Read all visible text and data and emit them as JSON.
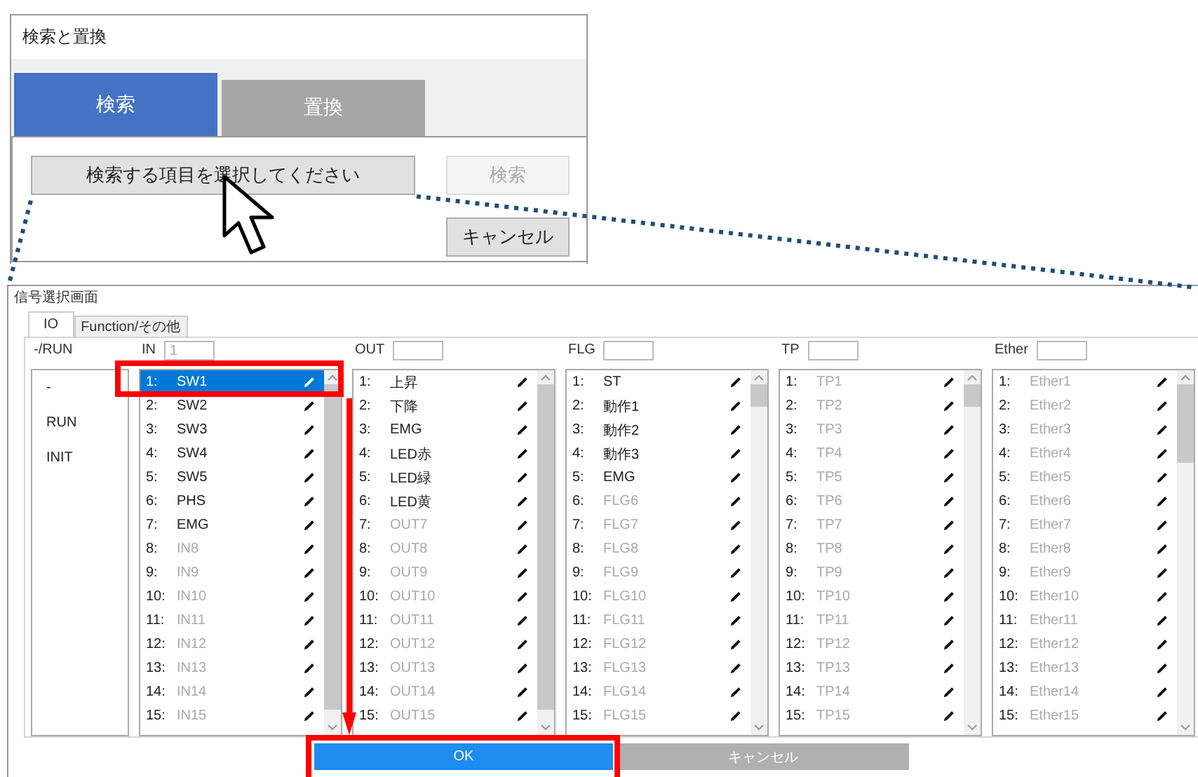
{
  "search_dialog": {
    "title": "検索と置換",
    "tabs": [
      {
        "label": "検索",
        "selected": true
      },
      {
        "label": "置換",
        "selected": false
      }
    ],
    "select_button": "検索する項目を選択してください",
    "search_button": {
      "label": "検索",
      "disabled": true
    },
    "cancel_button": {
      "label": "キャンセル",
      "disabled": false
    }
  },
  "signal_dialog": {
    "title": "信号選択画面",
    "tabs": [
      {
        "label": "IO",
        "selected": true
      },
      {
        "label": "Function/その他",
        "selected": false
      }
    ],
    "mode_list": {
      "header": "-/RUN",
      "items": [
        {
          "label": "-",
          "selected": false
        },
        {
          "label": "RUN",
          "selected": false
        },
        {
          "label": "INIT",
          "selected": false
        }
      ]
    },
    "groups": [
      {
        "header": "IN",
        "filter": "1",
        "items": [
          {
            "number": "1:",
            "label": "SW1",
            "named": true,
            "selected": true
          },
          {
            "number": "2:",
            "label": "SW2",
            "named": true,
            "selected": false
          },
          {
            "number": "3:",
            "label": "SW3",
            "named": true,
            "selected": false
          },
          {
            "number": "4:",
            "label": "SW4",
            "named": true,
            "selected": false
          },
          {
            "number": "5:",
            "label": "SW5",
            "named": true,
            "selected": false
          },
          {
            "number": "6:",
            "label": "PHS",
            "named": true,
            "selected": false
          },
          {
            "number": "7:",
            "label": "EMG",
            "named": true,
            "selected": false
          },
          {
            "number": "8:",
            "label": "IN8",
            "named": false,
            "selected": false
          },
          {
            "number": "9:",
            "label": "IN9",
            "named": false,
            "selected": false
          },
          {
            "number": "10:",
            "label": "IN10",
            "named": false,
            "selected": false
          },
          {
            "number": "11:",
            "label": "IN11",
            "named": false,
            "selected": false
          },
          {
            "number": "12:",
            "label": "IN12",
            "named": false,
            "selected": false
          },
          {
            "number": "13:",
            "label": "IN13",
            "named": false,
            "selected": false
          },
          {
            "number": "14:",
            "label": "IN14",
            "named": false,
            "selected": false
          },
          {
            "number": "15:",
            "label": "IN15",
            "named": false,
            "selected": false
          }
        ]
      },
      {
        "header": "OUT",
        "items": [
          {
            "number": "1:",
            "label": "上昇",
            "named": true,
            "selected": false
          },
          {
            "number": "2:",
            "label": "下降",
            "named": true,
            "selected": false
          },
          {
            "number": "3:",
            "label": "EMG",
            "named": true,
            "selected": false
          },
          {
            "number": "4:",
            "label": "LED赤",
            "named": true,
            "selected": false
          },
          {
            "number": "5:",
            "label": "LED緑",
            "named": true,
            "selected": false
          },
          {
            "number": "6:",
            "label": "LED黄",
            "named": true,
            "selected": false
          },
          {
            "number": "7:",
            "label": "OUT7",
            "named": false,
            "selected": false
          },
          {
            "number": "8:",
            "label": "OUT8",
            "named": false,
            "selected": false
          },
          {
            "number": "9:",
            "label": "OUT9",
            "named": false,
            "selected": false
          },
          {
            "number": "10:",
            "label": "OUT10",
            "named": false,
            "selected": false
          },
          {
            "number": "11:",
            "label": "OUT11",
            "named": false,
            "selected": false
          },
          {
            "number": "12:",
            "label": "OUT12",
            "named": false,
            "selected": false
          },
          {
            "number": "13:",
            "label": "OUT13",
            "named": false,
            "selected": false
          },
          {
            "number": "14:",
            "label": "OUT14",
            "named": false,
            "selected": false
          },
          {
            "number": "15:",
            "label": "OUT15",
            "named": false,
            "selected": false
          }
        ]
      },
      {
        "header": "FLG",
        "items": [
          {
            "number": "1:",
            "label": "ST",
            "named": true,
            "selected": false
          },
          {
            "number": "2:",
            "label": "動作1",
            "named": true,
            "selected": false
          },
          {
            "number": "3:",
            "label": "動作2",
            "named": true,
            "selected": false
          },
          {
            "number": "4:",
            "label": "動作3",
            "named": true,
            "selected": false
          },
          {
            "number": "5:",
            "label": "EMG",
            "named": true,
            "selected": false
          },
          {
            "number": "6:",
            "label": "FLG6",
            "named": false,
            "selected": false
          },
          {
            "number": "7:",
            "label": "FLG7",
            "named": false,
            "selected": false
          },
          {
            "number": "8:",
            "label": "FLG8",
            "named": false,
            "selected": false
          },
          {
            "number": "9:",
            "label": "FLG9",
            "named": false,
            "selected": false
          },
          {
            "number": "10:",
            "label": "FLG10",
            "named": false,
            "selected": false
          },
          {
            "number": "11:",
            "label": "FLG11",
            "named": false,
            "selected": false
          },
          {
            "number": "12:",
            "label": "FLG12",
            "named": false,
            "selected": false
          },
          {
            "number": "13:",
            "label": "FLG13",
            "named": false,
            "selected": false
          },
          {
            "number": "14:",
            "label": "FLG14",
            "named": false,
            "selected": false
          },
          {
            "number": "15:",
            "label": "FLG15",
            "named": false,
            "selected": false
          }
        ]
      },
      {
        "header": "TP",
        "items": [
          {
            "number": "1:",
            "label": "TP1",
            "named": false,
            "selected": false
          },
          {
            "number": "2:",
            "label": "TP2",
            "named": false,
            "selected": false
          },
          {
            "number": "3:",
            "label": "TP3",
            "named": false,
            "selected": false
          },
          {
            "number": "4:",
            "label": "TP4",
            "named": false,
            "selected": false
          },
          {
            "number": "5:",
            "label": "TP5",
            "named": false,
            "selected": false
          },
          {
            "number": "6:",
            "label": "TP6",
            "named": false,
            "selected": false
          },
          {
            "number": "7:",
            "label": "TP7",
            "named": false,
            "selected": false
          },
          {
            "number": "8:",
            "label": "TP8",
            "named": false,
            "selected": false
          },
          {
            "number": "9:",
            "label": "TP9",
            "named": false,
            "selected": false
          },
          {
            "number": "10:",
            "label": "TP10",
            "named": false,
            "selected": false
          },
          {
            "number": "11:",
            "label": "TP11",
            "named": false,
            "selected": false
          },
          {
            "number": "12:",
            "label": "TP12",
            "named": false,
            "selected": false
          },
          {
            "number": "13:",
            "label": "TP13",
            "named": false,
            "selected": false
          },
          {
            "number": "14:",
            "label": "TP14",
            "named": false,
            "selected": false
          },
          {
            "number": "15:",
            "label": "TP15",
            "named": false,
            "selected": false
          }
        ]
      },
      {
        "header": "Ether",
        "items": [
          {
            "number": "1:",
            "label": "Ether1",
            "named": false,
            "selected": false
          },
          {
            "number": "2:",
            "label": "Ether2",
            "named": false,
            "selected": false
          },
          {
            "number": "3:",
            "label": "Ether3",
            "named": false,
            "selected": false
          },
          {
            "number": "4:",
            "label": "Ether4",
            "named": false,
            "selected": false
          },
          {
            "number": "5:",
            "label": "Ether5",
            "named": false,
            "selected": false
          },
          {
            "number": "6:",
            "label": "Ether6",
            "named": false,
            "selected": false
          },
          {
            "number": "7:",
            "label": "Ether7",
            "named": false,
            "selected": false
          },
          {
            "number": "8:",
            "label": "Ether8",
            "named": false,
            "selected": false
          },
          {
            "number": "9:",
            "label": "Ether9",
            "named": false,
            "selected": false
          },
          {
            "number": "10:",
            "label": "Ether10",
            "named": false,
            "selected": false
          },
          {
            "number": "11:",
            "label": "Ether11",
            "named": false,
            "selected": false
          },
          {
            "number": "12:",
            "label": "Ether12",
            "named": false,
            "selected": false
          },
          {
            "number": "13:",
            "label": "Ether13",
            "named": false,
            "selected": false
          },
          {
            "number": "14:",
            "label": "Ether14",
            "named": false,
            "selected": false
          },
          {
            "number": "15:",
            "label": "Ether15",
            "named": false,
            "selected": false
          }
        ]
      }
    ],
    "ok_button": "OK",
    "cancel_button": {
      "label": "キャンセル",
      "disabled": true
    }
  }
}
